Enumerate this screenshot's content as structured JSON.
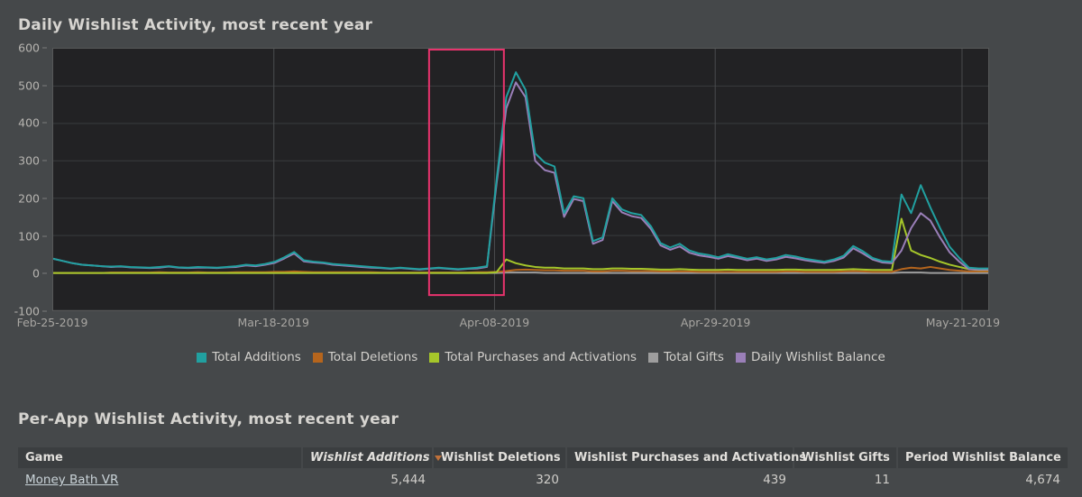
{
  "chart_section": {
    "title": "Daily Wishlist Activity, most recent year"
  },
  "table_section": {
    "title": "Per-App Wishlist Activity, most recent year",
    "columns": [
      {
        "label": "Game",
        "align": "left",
        "sorted": false
      },
      {
        "label": "Wishlist Additions",
        "align": "right",
        "sorted": true
      },
      {
        "label": "Wishlist Deletions",
        "align": "right",
        "sorted": false
      },
      {
        "label": "Wishlist Purchases and Activations",
        "align": "right",
        "sorted": false
      },
      {
        "label": "Wishlist Gifts",
        "align": "right",
        "sorted": false
      },
      {
        "label": "Period Wishlist Balance",
        "align": "right",
        "sorted": false
      }
    ],
    "rows": [
      {
        "game": "Money Bath VR",
        "wishlist_additions": "5,444",
        "wishlist_deletions": "320",
        "wishlist_purchases_and_activations": "439",
        "wishlist_gifts": "11",
        "period_wishlist_balance": "4,674"
      }
    ]
  },
  "selection": {
    "name": "selection-rectangle",
    "color": "#e8336d",
    "x_start_ratio": 0.402,
    "x_end_ratio": 0.482
  },
  "chart_data": {
    "type": "line",
    "title": "Daily Wishlist Activity, most recent year",
    "xlabel": "",
    "ylabel": "",
    "ylim": [
      -100,
      600
    ],
    "ytick_values": [
      600,
      500,
      400,
      300,
      200,
      100,
      0,
      -100
    ],
    "grid": true,
    "legend_position": "bottom",
    "xtick_labels": [
      "Feb-25-2019",
      "Mar-18-2019",
      "Apr-08-2019",
      "Apr-29-2019",
      "May-21-2019"
    ],
    "xtick_positions": [
      0.0,
      0.236,
      0.472,
      0.708,
      0.972
    ],
    "x_count": 86,
    "series": [
      {
        "name": "Total Additions",
        "color": "#21a0a0",
        "values": [
          38,
          32,
          26,
          22,
          20,
          18,
          17,
          18,
          16,
          15,
          14,
          16,
          18,
          15,
          14,
          16,
          15,
          14,
          16,
          18,
          22,
          20,
          24,
          30,
          42,
          56,
          34,
          30,
          28,
          24,
          22,
          20,
          18,
          16,
          14,
          12,
          14,
          12,
          10,
          12,
          14,
          12,
          10,
          12,
          14,
          18,
          250,
          470,
          537,
          490,
          320,
          295,
          285,
          160,
          205,
          200,
          85,
          95,
          200,
          170,
          160,
          155,
          125,
          80,
          68,
          78,
          60,
          52,
          48,
          42,
          50,
          44,
          38,
          42,
          36,
          40,
          48,
          44,
          38,
          34,
          30,
          36,
          46,
          72,
          58,
          40,
          32,
          30,
          210,
          160,
          235,
          175,
          120,
          70,
          40,
          14,
          12,
          12
        ]
      },
      {
        "name": "Total Deletions",
        "color": "#b5651d",
        "values": [
          0,
          0,
          0,
          0,
          0,
          0,
          1,
          1,
          1,
          1,
          1,
          2,
          1,
          1,
          1,
          2,
          1,
          1,
          1,
          2,
          2,
          2,
          2,
          3,
          3,
          4,
          3,
          2,
          2,
          2,
          2,
          2,
          2,
          2,
          1,
          1,
          1,
          1,
          1,
          1,
          1,
          1,
          1,
          1,
          2,
          2,
          3,
          5,
          8,
          9,
          8,
          7,
          7,
          6,
          6,
          6,
          4,
          4,
          6,
          6,
          5,
          5,
          5,
          4,
          4,
          4,
          4,
          3,
          3,
          3,
          3,
          3,
          3,
          3,
          3,
          3,
          4,
          4,
          3,
          3,
          3,
          3,
          4,
          5,
          4,
          3,
          3,
          3,
          10,
          14,
          12,
          16,
          12,
          8,
          6,
          4,
          4,
          4
        ]
      },
      {
        "name": "Total Purchases and Activations",
        "color": "#a5c62a",
        "values": [
          0,
          0,
          0,
          0,
          0,
          0,
          0,
          0,
          0,
          0,
          0,
          0,
          0,
          0,
          0,
          0,
          0,
          0,
          0,
          0,
          0,
          0,
          0,
          0,
          0,
          0,
          0,
          0,
          0,
          0,
          0,
          0,
          0,
          0,
          0,
          0,
          0,
          0,
          0,
          0,
          0,
          0,
          0,
          0,
          0,
          0,
          2,
          36,
          26,
          20,
          16,
          14,
          14,
          12,
          12,
          12,
          10,
          10,
          12,
          12,
          11,
          11,
          10,
          9,
          9,
          10,
          9,
          8,
          8,
          8,
          9,
          8,
          8,
          8,
          8,
          8,
          9,
          9,
          8,
          8,
          8,
          8,
          9,
          10,
          9,
          8,
          8,
          8,
          145,
          60,
          48,
          40,
          30,
          22,
          16,
          10,
          8,
          8
        ]
      },
      {
        "name": "Total Gifts",
        "color": "#9e9e9e",
        "values": [
          0,
          0,
          0,
          0,
          0,
          0,
          0,
          0,
          0,
          0,
          0,
          0,
          0,
          0,
          0,
          0,
          0,
          0,
          0,
          0,
          0,
          0,
          0,
          0,
          0,
          0,
          0,
          0,
          0,
          0,
          0,
          0,
          0,
          0,
          0,
          0,
          0,
          0,
          0,
          0,
          0,
          0,
          0,
          0,
          0,
          0,
          0,
          1,
          1,
          1,
          1,
          0,
          0,
          0,
          0,
          0,
          0,
          0,
          0,
          0,
          0,
          0,
          0,
          0,
          0,
          0,
          0,
          0,
          0,
          0,
          0,
          0,
          0,
          0,
          0,
          0,
          0,
          0,
          0,
          0,
          0,
          0,
          0,
          0,
          0,
          0,
          0,
          0,
          1,
          1,
          1,
          0,
          0,
          0,
          0,
          0,
          0,
          0
        ]
      },
      {
        "name": "Daily Wishlist Balance",
        "color": "#9a7fb8",
        "values": [
          38,
          32,
          26,
          22,
          20,
          18,
          16,
          17,
          15,
          14,
          13,
          14,
          17,
          14,
          13,
          14,
          14,
          13,
          15,
          16,
          20,
          18,
          22,
          27,
          39,
          52,
          31,
          28,
          26,
          22,
          20,
          18,
          16,
          14,
          13,
          11,
          13,
          11,
          9,
          11,
          13,
          11,
          9,
          11,
          12,
          16,
          240,
          440,
          510,
          470,
          300,
          275,
          268,
          150,
          198,
          192,
          78,
          88,
          192,
          162,
          152,
          147,
          118,
          74,
          62,
          71,
          54,
          47,
          43,
          38,
          45,
          40,
          34,
          38,
          32,
          36,
          43,
          39,
          34,
          30,
          27,
          32,
          41,
          66,
          52,
          36,
          28,
          26,
          60,
          120,
          160,
          140,
          95,
          55,
          30,
          10,
          9,
          9
        ]
      }
    ]
  }
}
